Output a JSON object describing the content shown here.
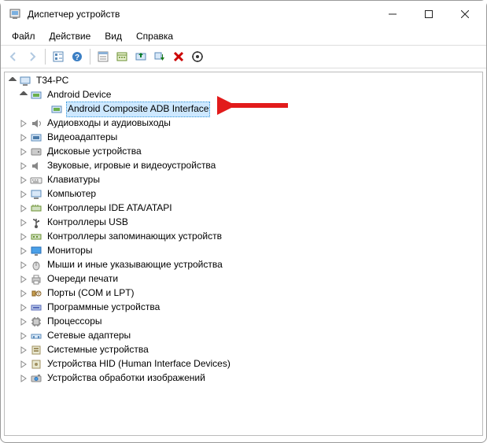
{
  "window": {
    "title": "Диспетчер устройств"
  },
  "menu": {
    "file": "Файл",
    "action": "Действие",
    "view": "Вид",
    "help": "Справка"
  },
  "toolbar_icons": {
    "back": "back-icon",
    "forward": "forward-icon",
    "refresh_tree": "refresh-tree-icon",
    "show_hidden": "show-hidden-icon",
    "help": "help-icon",
    "properties": "properties-icon",
    "update": "update-driver-icon",
    "disable": "disable-icon",
    "uninstall": "uninstall-icon",
    "scan": "scan-hardware-icon"
  },
  "tree": {
    "root": "T34-PC",
    "android_device": "Android Device",
    "android_adb": "Android Composite ADB Interface",
    "categories": [
      "Аудиовходы и аудиовыходы",
      "Видеоадаптеры",
      "Дисковые устройства",
      "Звуковые, игровые и видеоустройства",
      "Клавиатуры",
      "Компьютер",
      "Контроллеры IDE ATA/ATAPI",
      "Контроллеры USB",
      "Контроллеры запоминающих устройств",
      "Мониторы",
      "Мыши и иные указывающие устройства",
      "Очереди печати",
      "Порты (COM и LPT)",
      "Программные устройства",
      "Процессоры",
      "Сетевые адаптеры",
      "Системные устройства",
      "Устройства HID (Human Interface Devices)",
      "Устройства обработки изображений"
    ]
  }
}
